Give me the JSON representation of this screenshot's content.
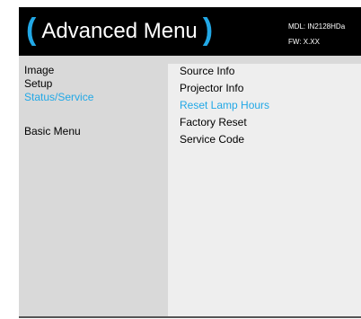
{
  "header": {
    "paren_open": "(",
    "title": "Advanced Menu",
    "paren_close": ")",
    "model": "MDL: IN2128HDa",
    "firmware": "FW: X.XX"
  },
  "left_menu": {
    "items": [
      {
        "label": "Image",
        "active": false
      },
      {
        "label": "Setup",
        "active": false
      },
      {
        "label": "Status/Service",
        "active": true
      }
    ],
    "basic_menu_label": "Basic Menu"
  },
  "right_panel": {
    "items": [
      {
        "label": "Source Info",
        "active": false
      },
      {
        "label": "Projector Info",
        "active": false
      },
      {
        "label": "Reset Lamp Hours",
        "active": true
      },
      {
        "label": "Factory Reset",
        "active": false
      },
      {
        "label": "Service Code",
        "active": false
      }
    ]
  },
  "colors": {
    "accent": "#22a8e6",
    "header_bg": "#000000",
    "panel_bg": "#d9d9d9",
    "submenu_bg": "#eeeeee"
  }
}
